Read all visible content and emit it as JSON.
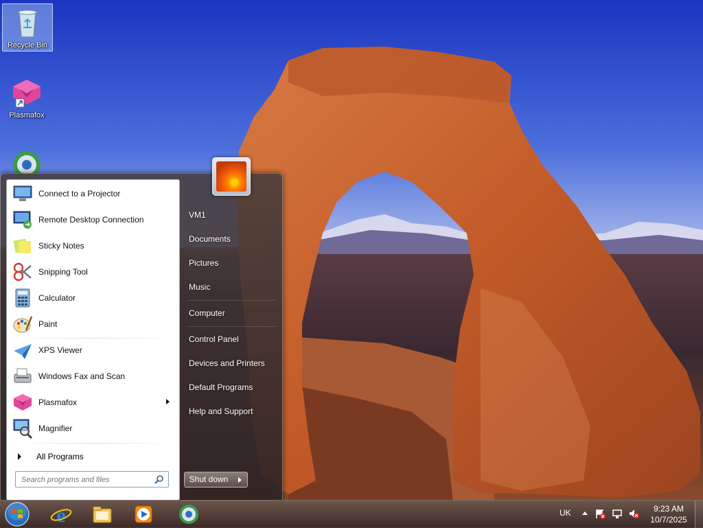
{
  "desktop": {
    "icons": [
      {
        "label": "Recycle Bin"
      },
      {
        "label": "Plasmafox"
      },
      {
        "label": ""
      }
    ]
  },
  "start_menu": {
    "programs": [
      {
        "label": "Connect to a Projector",
        "icon": "projector-icon"
      },
      {
        "label": "Remote Desktop Connection",
        "icon": "remote-desktop-icon"
      },
      {
        "label": "Sticky Notes",
        "icon": "sticky-notes-icon"
      },
      {
        "label": "Snipping Tool",
        "icon": "scissors-icon"
      },
      {
        "label": "Calculator",
        "icon": "calculator-icon"
      },
      {
        "label": "Paint",
        "icon": "paint-palette-icon"
      },
      {
        "label": "XPS Viewer",
        "icon": "xps-viewer-icon"
      },
      {
        "label": "Windows Fax and Scan",
        "icon": "fax-icon"
      },
      {
        "label": "Plasmafox",
        "icon": "plasmafox-icon",
        "has_submenu": true
      },
      {
        "label": "Magnifier",
        "icon": "magnifier-icon"
      }
    ],
    "all_programs": "All Programs",
    "search": {
      "placeholder": "Search programs and files"
    },
    "places": [
      {
        "label": "VM1"
      },
      {
        "label": "Documents"
      },
      {
        "label": "Pictures"
      },
      {
        "label": "Music"
      },
      {
        "label": "Computer"
      },
      {
        "label": "Control Panel"
      },
      {
        "label": "Devices and Printers"
      },
      {
        "label": "Default Programs"
      },
      {
        "label": "Help and Support"
      }
    ],
    "shutdown_label": "Shut down"
  },
  "taskbar": {
    "pinned": [
      "internet-explorer-icon",
      "file-explorer-icon",
      "media-player-icon",
      "network-globe-icon"
    ],
    "tray": {
      "language": "UK",
      "time": "9:23 AM",
      "date": "10/7/2025"
    }
  },
  "colors": {
    "sky": "#2a4fd0",
    "rock": "#c8642e",
    "plasmafox": "#e0459c"
  }
}
